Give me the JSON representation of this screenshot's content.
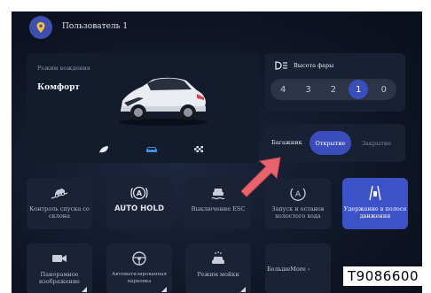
{
  "header": {
    "username": "Пользователь 1",
    "avatar_icon": "map-pin-icon"
  },
  "drive": {
    "label": "Режим вождения",
    "mode": "Комфорт",
    "modes": [
      {
        "icon": "leaf-icon",
        "selected": false
      },
      {
        "icon": "car-icon",
        "selected": true
      },
      {
        "icon": "race-flag-icon",
        "selected": false
      }
    ]
  },
  "headlight": {
    "title": "Высота фары",
    "icon": "headlight-icon",
    "options": [
      "4",
      "3",
      "2",
      "1",
      "0"
    ],
    "selected": "1"
  },
  "trunk": {
    "title": "Багажник",
    "open_label": "Открытие",
    "close_label": "Закрытие",
    "selected": "open"
  },
  "tiles": {
    "hill_descent": "Контроль спуска со склона",
    "auto_hold_icon_letter": "A",
    "auto_hold": "AUTO HOLD",
    "esc_off": "Выключение ESC",
    "start_stop_icon_letter": "A",
    "start_stop": "Запуск и останов холостого хода",
    "lane_keep": "Удержание в полосе движения",
    "panoramic": "Панорамное изображение",
    "auto_parking": "Автоматизированная парковка",
    "wash_mode": "Режим мойки",
    "more": "БольшеMore"
  },
  "stamp": "T9086600",
  "colors": {
    "accent": "#3b4dbd",
    "arrow": "#e8636b",
    "background": "#0d1322"
  }
}
